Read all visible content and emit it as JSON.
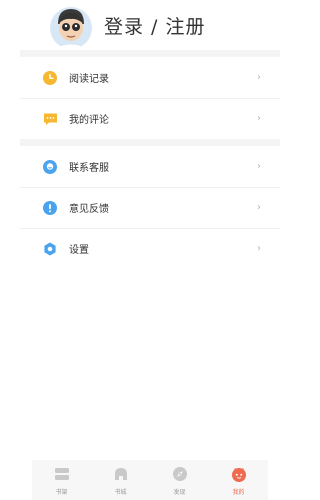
{
  "profile": {
    "login_label": "登录 / 注册",
    "avatar_icon": "cartoon-avatar-icon"
  },
  "menu": [
    {
      "label": "阅读记录",
      "icon": "clock-icon",
      "color": "#f6b731"
    },
    {
      "label": "我的评论",
      "icon": "comment-icon",
      "color": "#f6b731"
    },
    {
      "label": "联系客服",
      "icon": "customer-service-icon",
      "color": "#4aa3ee"
    },
    {
      "label": "意见反馈",
      "icon": "exclamation-icon",
      "color": "#4aa3ee"
    },
    {
      "label": "设置",
      "icon": "settings-icon",
      "color": "#4aa3ee"
    }
  ],
  "tabbar": [
    {
      "label": "书架",
      "icon": "bookshelf-icon"
    },
    {
      "label": "书城",
      "icon": "bookstore-icon"
    },
    {
      "label": "发现",
      "icon": "discover-icon"
    },
    {
      "label": "我的",
      "icon": "mine-icon",
      "active": true
    }
  ],
  "colors": {
    "accent": "#f06a50",
    "inactive": "#c9c9c9"
  }
}
